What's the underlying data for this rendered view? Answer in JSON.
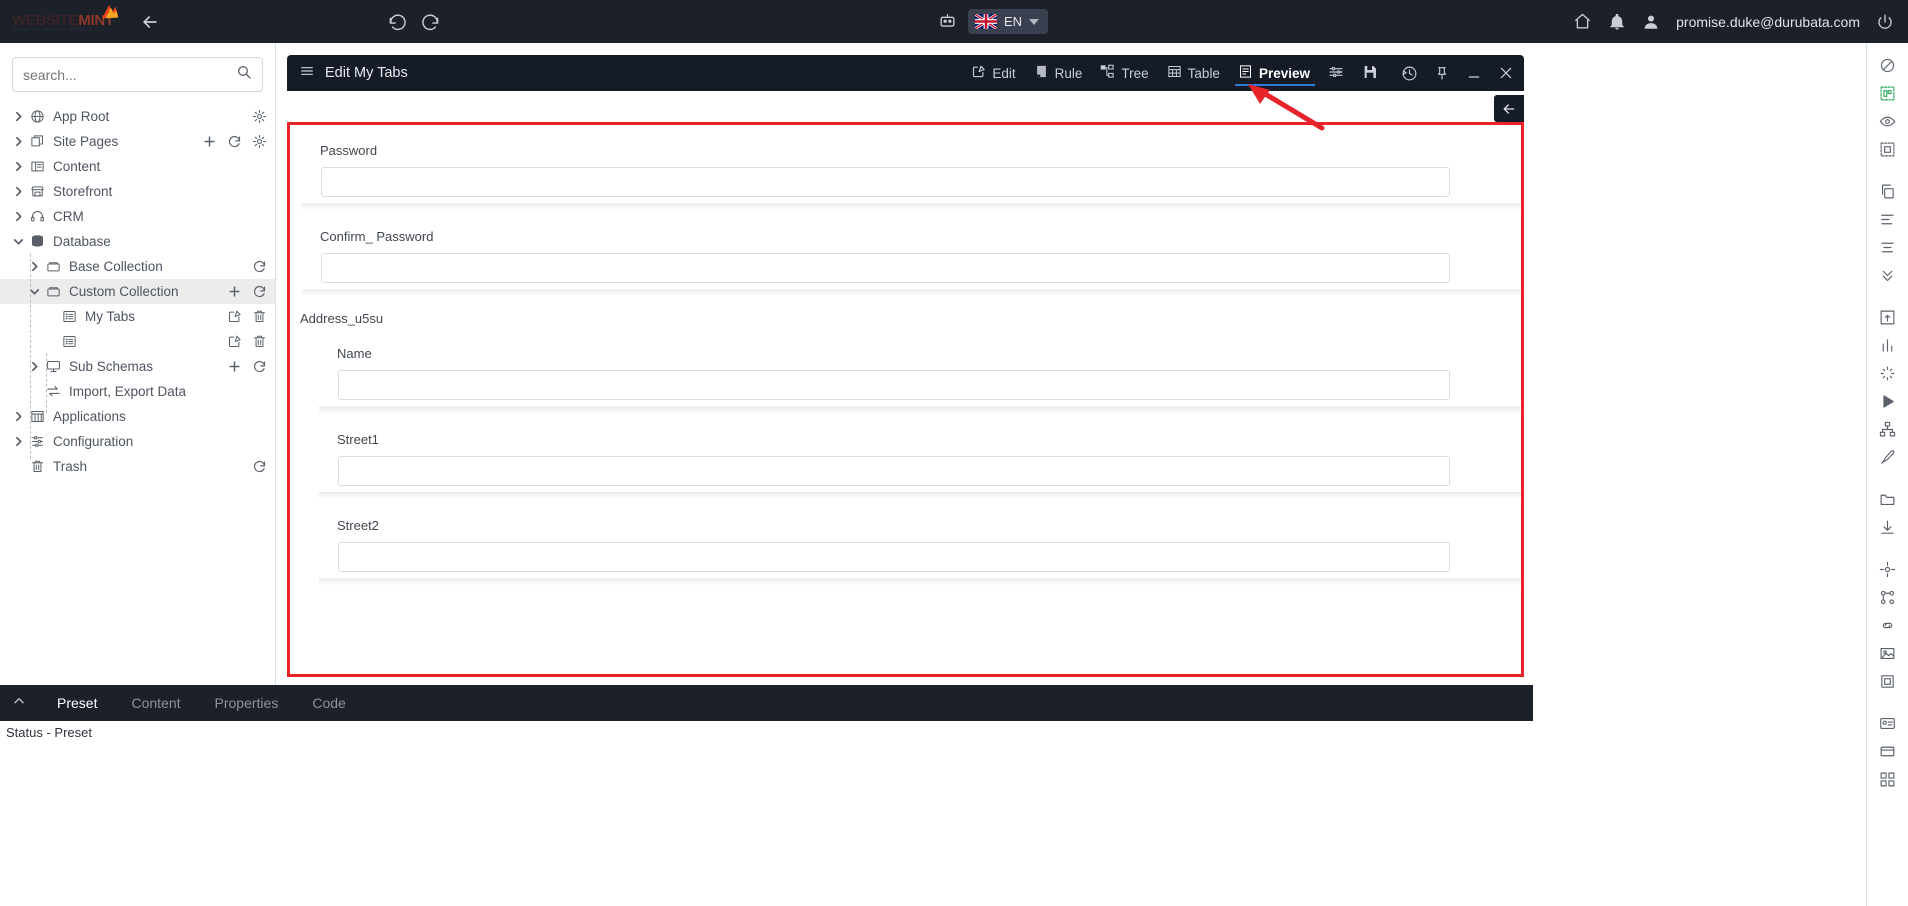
{
  "topbar": {
    "logo": {
      "part1": "WEBSITE",
      "part2": "MINT",
      "tagline": "CREATE • DESIGN • MANAGE"
    },
    "back_icon": "arrow-left-icon",
    "undo_icon": "undo-icon",
    "redo_icon": "redo-icon",
    "bot_icon": "robot-icon",
    "language": {
      "code": "EN",
      "flag": "uk-flag-icon"
    },
    "home_icon": "home-icon",
    "bell_icon": "bell-icon",
    "person_icon": "person-icon",
    "user_email": "promise.duke@durubata.com",
    "power_icon": "power-icon"
  },
  "sidebar": {
    "search": {
      "placeholder": "search...",
      "value": "",
      "icon": "search-icon"
    },
    "items": [
      {
        "label": "App Root",
        "icon": "globe-icon",
        "chevron": "right",
        "indent": 0,
        "actions": [
          "gear-icon"
        ]
      },
      {
        "label": "Site Pages",
        "icon": "pages-icon",
        "chevron": "right",
        "indent": 0,
        "actions": [
          "plus-icon",
          "refresh-icon",
          "gear-icon"
        ]
      },
      {
        "label": "Content",
        "icon": "content-icon",
        "chevron": "right",
        "indent": 0,
        "actions": []
      },
      {
        "label": "Storefront",
        "icon": "store-icon",
        "chevron": "right",
        "indent": 0,
        "actions": []
      },
      {
        "label": "CRM",
        "icon": "headset-icon",
        "chevron": "right",
        "indent": 0,
        "actions": []
      },
      {
        "label": "Database",
        "icon": "database-icon",
        "chevron": "down",
        "indent": 0,
        "actions": []
      },
      {
        "label": "Base Collection",
        "icon": "box-icon",
        "chevron": "right",
        "indent": 1,
        "actions": [
          "refresh-icon"
        ]
      },
      {
        "label": "Custom Collection",
        "icon": "box-icon",
        "chevron": "down",
        "indent": 1,
        "actions": [
          "plus-icon",
          "refresh-icon"
        ],
        "selected": true
      },
      {
        "label": "My Tabs",
        "icon": "list-icon",
        "chevron": "none",
        "indent": 2,
        "actions": [
          "edit-icon",
          "trash-icon"
        ]
      },
      {
        "label": "",
        "icon": "list-icon",
        "chevron": "none",
        "indent": 2,
        "actions": [
          "edit-icon",
          "trash-icon"
        ]
      },
      {
        "label": "Sub Schemas",
        "icon": "monitor-icon",
        "chevron": "right",
        "indent": 1,
        "actions": [
          "plus-icon",
          "refresh-icon"
        ]
      },
      {
        "label": "Import, Export Data",
        "icon": "transfer-icon",
        "chevron": "none",
        "indent": 1,
        "actions": []
      },
      {
        "label": "Applications",
        "icon": "apps-icon",
        "chevron": "right",
        "indent": 0,
        "actions": []
      },
      {
        "label": "Configuration",
        "icon": "sliders-icon",
        "chevron": "right",
        "indent": 0,
        "actions": []
      },
      {
        "label": "Trash",
        "icon": "trash-icon",
        "chevron": "none",
        "indent": 0,
        "actions": [
          "refresh-icon"
        ]
      }
    ]
  },
  "window": {
    "title": "Edit My Tabs",
    "menu_icon": "hamburger-icon",
    "tools": [
      {
        "label": "Edit",
        "icon": "edit-icon",
        "active": false
      },
      {
        "label": "Rule",
        "icon": "rule-icon",
        "active": false
      },
      {
        "label": "Tree",
        "icon": "tree-icon",
        "active": false
      },
      {
        "label": "Table",
        "icon": "table-icon",
        "active": false
      },
      {
        "label": "Preview",
        "icon": "preview-icon",
        "active": true
      }
    ],
    "settings_icon": "sliders-icon",
    "save_icon": "save-icon",
    "history_icon": "history-icon",
    "pin_icon": "pin-icon",
    "minimize_icon": "minimize-icon",
    "close_icon": "close-icon",
    "collapse_icon": "arrow-left-icon"
  },
  "form": {
    "fields": [
      {
        "label": "Password",
        "value": "",
        "type": "text",
        "section": null
      },
      {
        "label": "Confirm_ Password",
        "value": "",
        "type": "text",
        "section": null
      }
    ],
    "section_title": "Address_u5su",
    "section_fields": [
      {
        "label": "Name",
        "value": ""
      },
      {
        "label": "Street1",
        "value": ""
      },
      {
        "label": "Street2",
        "value": ""
      }
    ]
  },
  "bottom": {
    "collapse_icon": "chevron-up-icon",
    "tabs": [
      {
        "label": "Preset",
        "active": true
      },
      {
        "label": "Content",
        "active": false
      },
      {
        "label": "Properties",
        "active": false
      },
      {
        "label": "Code",
        "active": false
      }
    ]
  },
  "status": {
    "text": "Status - Preset"
  },
  "rail": {
    "icons": [
      "block-icon",
      "select-region-icon",
      "eye-icon",
      "component-icon",
      "copy-icon",
      "align-left-icon",
      "align-center-icon",
      "collapse-icon",
      "export-icon",
      "chart-icon",
      "magic-icon",
      "play-icon",
      "hierarchy-icon",
      "brush-icon",
      "folder-icon",
      "download-icon",
      "target-icon",
      "nodes-icon",
      "link-icon",
      "image-icon",
      "frame-icon",
      "id-card-icon",
      "card-icon",
      "grid-icon"
    ]
  },
  "annotation": {
    "arrow_color": "#e8232a",
    "highlight_color": "#e8232a"
  }
}
